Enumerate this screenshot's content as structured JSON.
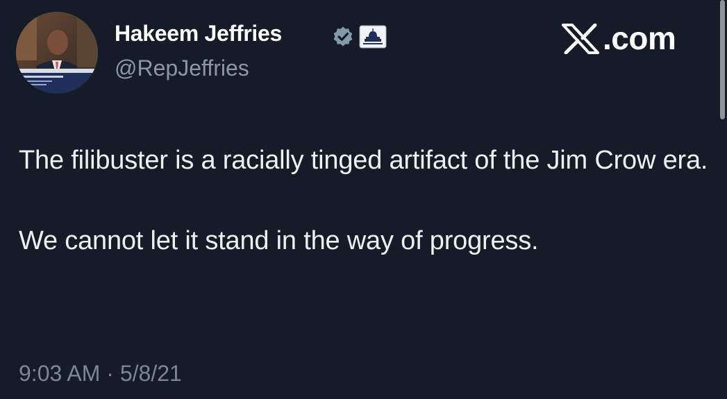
{
  "author": {
    "display_name": "Hakeem Jeffries",
    "handle": "@RepJeffries",
    "avatar_icon": "profile-photo",
    "verified_icon": "verified-badge-icon",
    "affiliation_icon": "us-capitol-government-badge-icon"
  },
  "brand": {
    "label": ".com",
    "logo_icon": "x-logo-icon"
  },
  "tweet": {
    "paragraphs": [
      "The filibuster is a racially tinged artifact of the Jim Crow era.",
      "We cannot let it stand in the way of progress."
    ],
    "timestamp": "9:03 AM · 5/8/21"
  },
  "colors": {
    "background": "#151c27",
    "text": "#eef1f4",
    "secondary_text": "#8b97a4",
    "verified_badge": "#829aab"
  }
}
